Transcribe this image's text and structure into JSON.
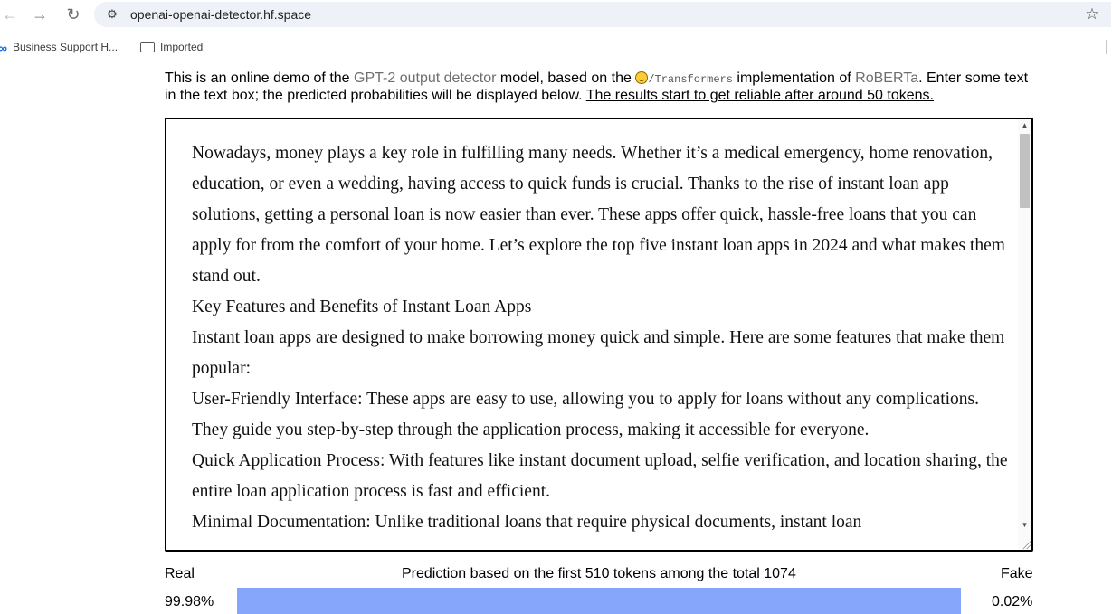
{
  "browser": {
    "url": "openai-openai-detector.hf.space",
    "bookmarks": [
      {
        "label": "Business Support H...",
        "icon": "meta-icon"
      },
      {
        "label": "Imported",
        "icon": "folder-icon"
      }
    ]
  },
  "intro": {
    "part1": "This is an online demo of the ",
    "link_detector": "GPT-2 output detector",
    "part2": " model, based on the ",
    "transformers": "/Transformers",
    "part3": " implementation of ",
    "link_roberta": "RoBERTa",
    "part4": ". Enter some text in the text box; the predicted probabilities will be displayed below. ",
    "note": "The results start to get reliable after around 50 tokens."
  },
  "textbox": {
    "paragraphs": [
      "Nowadays, money plays a key role in fulfilling many needs. Whether it’s a medical emergency, home renovation, education, or even a wedding, having access to quick funds is crucial. Thanks to the rise of instant loan app solutions, getting a personal loan is now easier than ever. These apps offer quick, hassle-free loans that you can apply for from the comfort of your home. Let’s explore the top five instant loan apps in 2024 and what makes them stand out.",
      "Key Features and Benefits of Instant Loan Apps",
      "Instant loan apps are designed to make borrowing money quick and simple. Here are some features that make them popular:",
      "User-Friendly Interface: These apps are easy to use, allowing you to apply for loans without any complications. They guide you step-by-step through the application process, making it accessible for everyone.",
      "Quick Application Process: With features like instant document upload, selfie verification, and location sharing, the entire loan application process is fast and efficient.",
      "Minimal Documentation: Unlike traditional loans that require physical documents, instant loan"
    ]
  },
  "result": {
    "real_label": "Real",
    "fake_label": "Fake",
    "prediction_text": "Prediction based on the first 510 tokens among the total 1074",
    "real_pct": "99.98%",
    "fake_pct": "0.02%",
    "real_fraction": 0.9998,
    "real_color": "#86a6fb",
    "fake_color": "#f06060"
  }
}
